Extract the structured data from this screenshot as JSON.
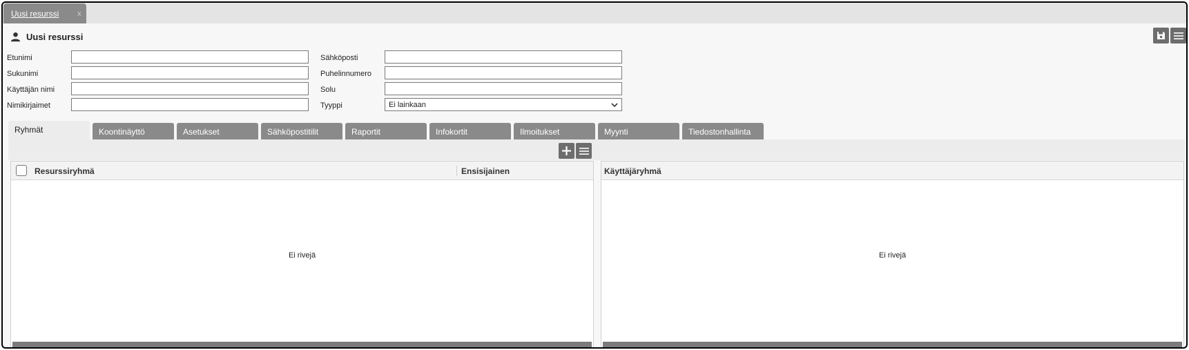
{
  "doc_tab": {
    "label": "Uusi resurssi",
    "close": "x"
  },
  "header": {
    "title": "Uusi resurssi"
  },
  "form": {
    "left": [
      {
        "label": "Etunimi",
        "value": ""
      },
      {
        "label": "Sukunimi",
        "value": ""
      },
      {
        "label": "Käyttäjän nimi",
        "value": ""
      },
      {
        "label": "Nimikirjaimet",
        "value": ""
      }
    ],
    "right": [
      {
        "label": "Sähköposti",
        "value": ""
      },
      {
        "label": "Puhelinnumero",
        "value": ""
      },
      {
        "label": "Solu",
        "value": ""
      },
      {
        "label": "Tyyppi",
        "value": "Ei lainkaan"
      }
    ]
  },
  "tabs": [
    "Ryhmät",
    "Koontinäyttö",
    "Asetukset",
    "Sähköpostitilit",
    "Raportit",
    "Infokortit",
    "Ilmoitukset",
    "Myynti",
    "Tiedostonhallinta"
  ],
  "active_tab": "Ryhmät",
  "resource_groups_grid": {
    "columns": [
      "Resurssiryhmä",
      "Ensisijainen"
    ],
    "empty_text": "Ei rivejä"
  },
  "user_groups_grid": {
    "columns": [
      "Käyttäjäryhmä"
    ],
    "empty_text": "Ei rivejä"
  },
  "icons": {
    "person": "person-icon",
    "save": "save-icon",
    "menu": "menu-icon",
    "add": "plus-icon",
    "select": "chevron-down-icon"
  },
  "colors": {
    "tab_gray": "#8a8a8a",
    "button_gray": "#6d6d6d",
    "background": "#f7f7f7"
  }
}
